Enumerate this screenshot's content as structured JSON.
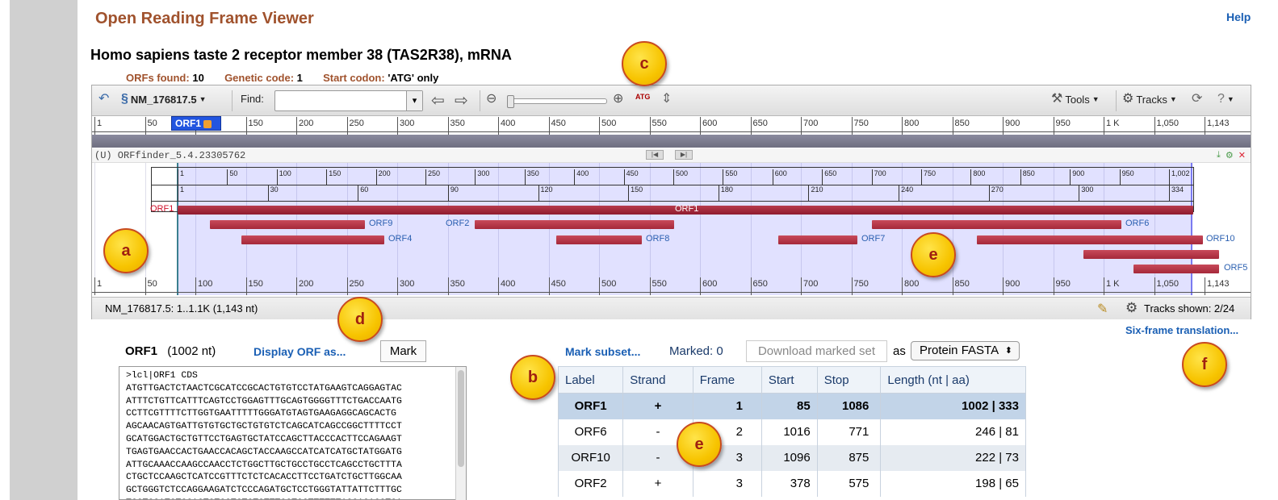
{
  "app_title": "Open Reading Frame Viewer",
  "help_link": "Help",
  "sequence_title": "Homo sapiens taste 2 receptor member 38 (TAS2R38), mRNA",
  "stats": {
    "orfs_found_label": "ORFs found:",
    "orfs_found_value": "10",
    "genetic_code_label": "Genetic code:",
    "genetic_code_value": "1",
    "start_codon_label": "Start codon:",
    "start_codon_value": "'ATG' only"
  },
  "toolbar": {
    "accession": "NM_176817.5",
    "find_label": "Find:",
    "find_placeholder": "",
    "tools_label": "Tools",
    "tracks_label": "Tracks",
    "atg_label": "ATG"
  },
  "ruler_labels": [
    "1",
    "50",
    "100",
    "150",
    "200",
    "250",
    "300",
    "350",
    "400",
    "450",
    "500",
    "550",
    "600",
    "650",
    "700",
    "750",
    "800",
    "850",
    "900",
    "950",
    "1 K",
    "1,050",
    "1,143"
  ],
  "selected_orf_badge": "ORF1",
  "track_name": "(U) ORFfinder_5.4.23305762",
  "inner_nt_labels": [
    "1",
    "50",
    "100",
    "150",
    "200",
    "250",
    "300",
    "350",
    "400",
    "450",
    "500",
    "550",
    "600",
    "650",
    "700",
    "750",
    "800",
    "850",
    "900",
    "950",
    "1,002"
  ],
  "inner_aa_labels": [
    "1",
    "30",
    "60",
    "90",
    "120",
    "150",
    "180",
    "210",
    "240",
    "270",
    "300",
    "334"
  ],
  "orf_labels": {
    "orf1_left": "ORF1",
    "orf1_center": "ORF1",
    "orf9": "ORF9",
    "orf2": "ORF2",
    "orf6": "ORF6",
    "orf4": "ORF4",
    "orf8": "ORF8",
    "orf7": "ORF7",
    "orf10": "ORF10",
    "orf5": "ORF5"
  },
  "status_bar": {
    "range": "NM_176817.5: 1..1.1K (1,143 nt)",
    "tracks_shown": "Tracks shown: 2/24"
  },
  "callouts": {
    "a": "a",
    "b": "b",
    "c": "c",
    "d": "d",
    "e1": "e",
    "e2": "e",
    "f": "f"
  },
  "orf_panel": {
    "name": "ORF1",
    "length": "(1002 nt)",
    "display_link": "Display ORF as...",
    "mark_button": "Mark",
    "sequence": ">lcl|ORF1 CDS\nATGTTGACTCTAACTCGCATCCGCACTGTGTCCTATGAAGTCAGGAGTAC\nATTTCTGTTCATTTCAGTCCTGGAGTTTGCAGTGGGGTTTCTGACCAATG\nCCTTCGTTTTCTTGGTGAATTTTTGGGATGTAGTGAAGAGGCAGCACTG\nAGCAACAGTGATTGTGTGCTGCTGTGTCTCAGCATCAGCCGGCTTTTCCT\nGCATGGACTGCTGTTCCTGAGTGCTATCCAGCTTACCCACTTCCAGAAGT\nTGAGTGAACCACTGAACCACAGCTACCAAGCCATCATCATGCTATGGATG\nATTGCAAACCAAGCCAACCTCTGGCTTGCTGCCTGCCTCAGCCTGCTTTA\nCTGCTCCAAGCTCATCCGTTTCTCTCACACCTTCCTGATCTGCTTGGCAA\nGCTGGGTCTCCAGGAAGATCTCCCAGATGCTCCTGGGTATTATTCTTTGC\nTCCTGCATCTGCACTGTCCTCTGTGTTTGGTGCTTTTTTAGCAGACCTCA"
  },
  "results": {
    "mark_subset": "Mark subset...",
    "marked": "Marked: 0",
    "download": "Download marked set",
    "as": "as",
    "format": "Protein FASTA",
    "six_frame": "Six-frame translation...",
    "columns": [
      "Label",
      "Strand",
      "Frame",
      "Start",
      "Stop",
      "Length (nt | aa)"
    ],
    "rows": [
      {
        "label": "ORF1",
        "strand": "+",
        "frame": "1",
        "start": "85",
        "stop": "1086",
        "length": "1002 | 333"
      },
      {
        "label": "ORF6",
        "strand": "-",
        "frame": "2",
        "start": "1016",
        "stop": "771",
        "length": "246 | 81"
      },
      {
        "label": "ORF10",
        "strand": "-",
        "frame": "3",
        "start": "1096",
        "stop": "875",
        "length": "222 | 73"
      },
      {
        "label": "ORF2",
        "strand": "+",
        "frame": "3",
        "start": "378",
        "stop": "575",
        "length": "198 | 65"
      }
    ]
  },
  "colors": {
    "title_brown": "#a0522d",
    "link_blue": "#1a5fb4",
    "orf_red": "#b73a4c",
    "selection": "#7878ff",
    "callout_yellow": "#f7c400"
  }
}
